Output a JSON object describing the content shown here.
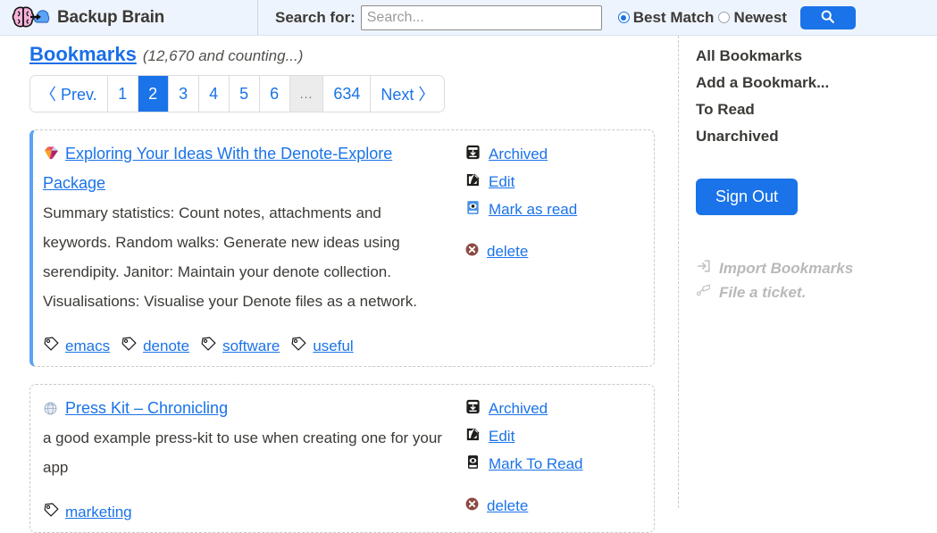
{
  "header": {
    "brand": "Backup Brain",
    "logo_icon": "brain-cloud-icon",
    "search_label": "Search for:",
    "search_value": "",
    "search_placeholder": "Search...",
    "sort_options": [
      {
        "label": "Best Match",
        "selected": true
      },
      {
        "label": "Newest",
        "selected": false
      }
    ],
    "search_button_icon": "search-icon",
    "accent_color": "#1a73e8",
    "background_color": "#eef4fd"
  },
  "main": {
    "title": "Bookmarks",
    "count_text": "(12,670 and counting...)",
    "pagination": {
      "prev_label": "〈 Prev.",
      "next_label": "Next 〉",
      "pages": [
        "1",
        "2",
        "3",
        "4",
        "5",
        "6"
      ],
      "ellipsis": "...",
      "last_page": "634",
      "current": "2"
    },
    "bookmarks": [
      {
        "favicon": "gem-diamond-favicon",
        "title": "Exploring Your Ideas With the Denote-Explore Package",
        "description": "Summary statistics: Count notes, attachments and keywords. Random walks: Generate new ideas using serendipity. Janitor: Maintain your denote collection. Visualisations: Visualise your Denote files as a network.",
        "tags": [
          "emacs",
          "denote",
          "software",
          "useful"
        ],
        "actions": [
          {
            "label": "Archived",
            "icon": "archive-box-icon"
          },
          {
            "label": "Edit",
            "icon": "edit-pencil-icon"
          },
          {
            "label": "Mark as read",
            "icon": "book-eye-icon"
          },
          {
            "label": "delete",
            "icon": "delete-circle-x-icon"
          }
        ],
        "accent": true
      },
      {
        "favicon": "globe-favicon",
        "title": "Press Kit – Chronicling",
        "description": "a good example press-kit to use when creating one for your app",
        "tags": [
          "marketing"
        ],
        "actions": [
          {
            "label": "Archived",
            "icon": "archive-box-icon"
          },
          {
            "label": "Edit",
            "icon": "edit-pencil-icon"
          },
          {
            "label": "Mark To Read",
            "icon": "book-eye-icon"
          },
          {
            "label": "delete",
            "icon": "delete-circle-x-icon"
          }
        ],
        "accent": false
      }
    ]
  },
  "sidebar": {
    "links": [
      "All Bookmarks",
      "Add a Bookmark...",
      "To Read",
      "Unarchived"
    ],
    "signout_label": "Sign Out",
    "footer": [
      {
        "label": "Import Bookmarks",
        "icon": "import-arrow-icon"
      },
      {
        "label": "File a ticket.",
        "icon": "ticket-icon"
      }
    ]
  }
}
